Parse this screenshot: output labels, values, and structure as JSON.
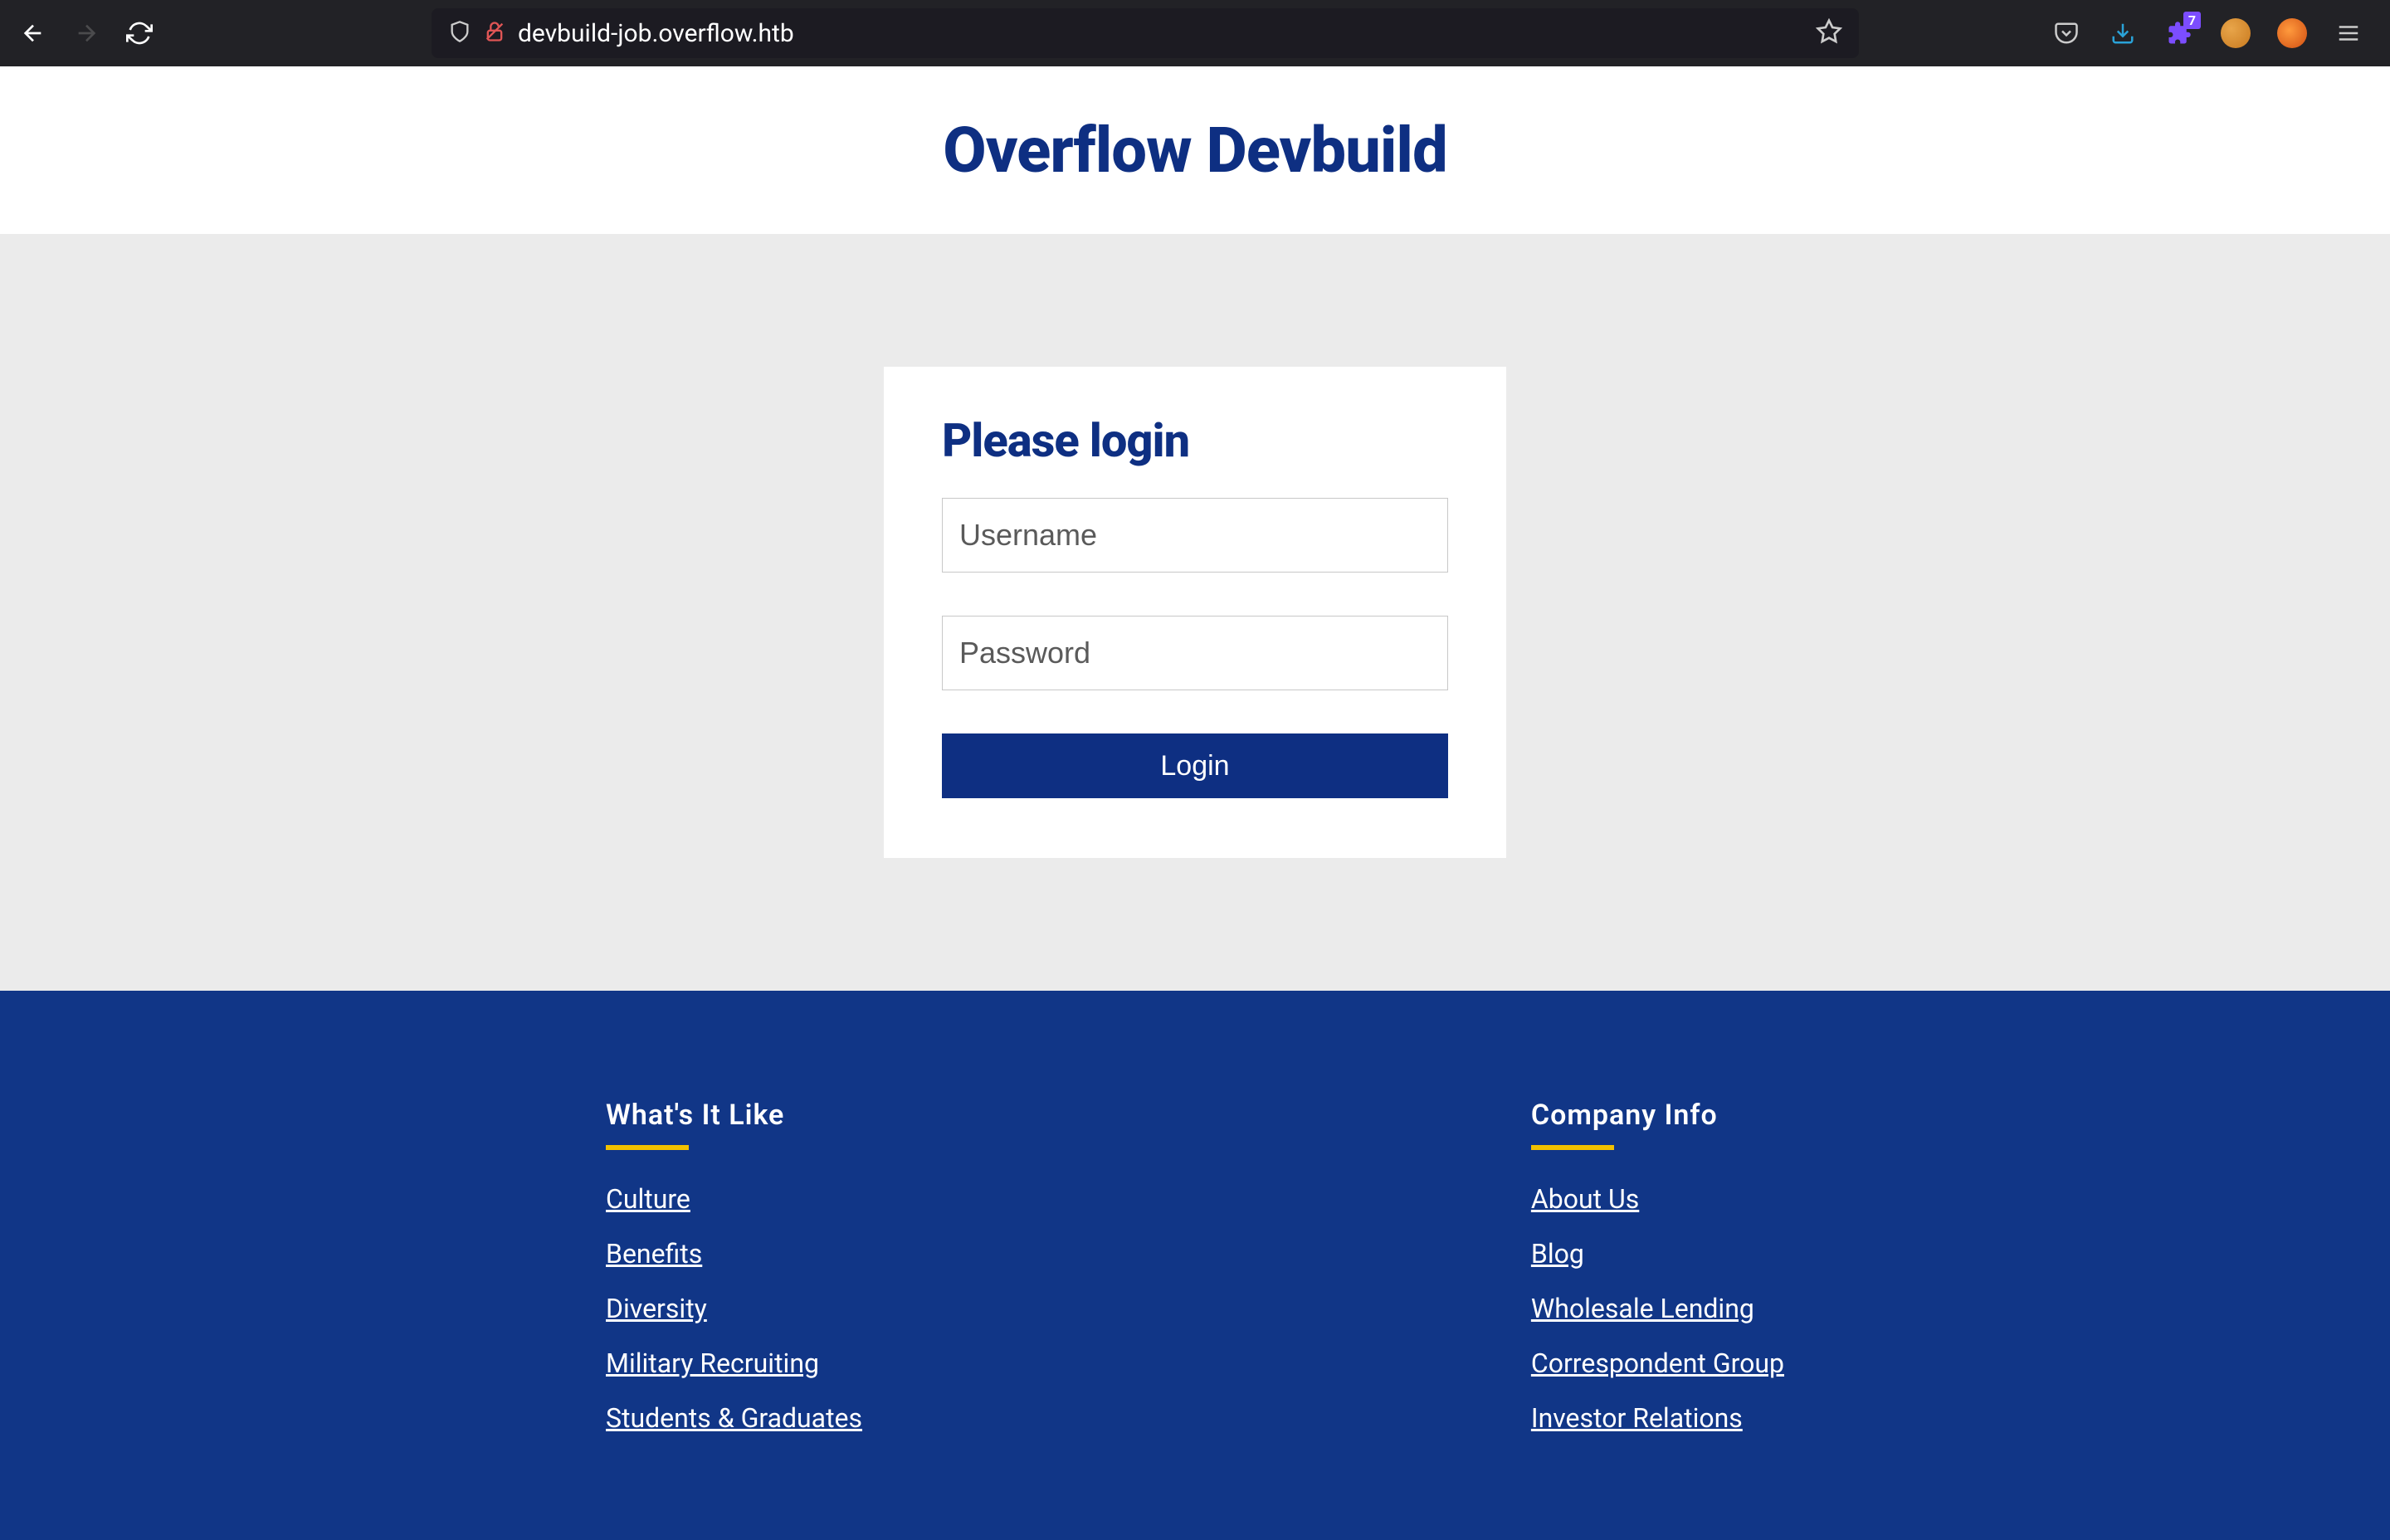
{
  "browser": {
    "url": "devbuild-job.overflow.htb",
    "badge_count": "7"
  },
  "header": {
    "title": "Overflow Devbuild"
  },
  "login": {
    "heading": "Please login",
    "username_placeholder": "Username",
    "password_placeholder": "Password",
    "button_label": "Login"
  },
  "footer": {
    "col1": {
      "heading": "What's It Like",
      "links": [
        "Culture",
        "Benefits",
        "Diversity",
        "Military Recruiting",
        "Students & Graduates"
      ]
    },
    "col2": {
      "heading": "Company Info",
      "links": [
        "About Us",
        "Blog",
        "Wholesale Lending",
        "Correspondent Group",
        "Investor Relations"
      ]
    }
  }
}
